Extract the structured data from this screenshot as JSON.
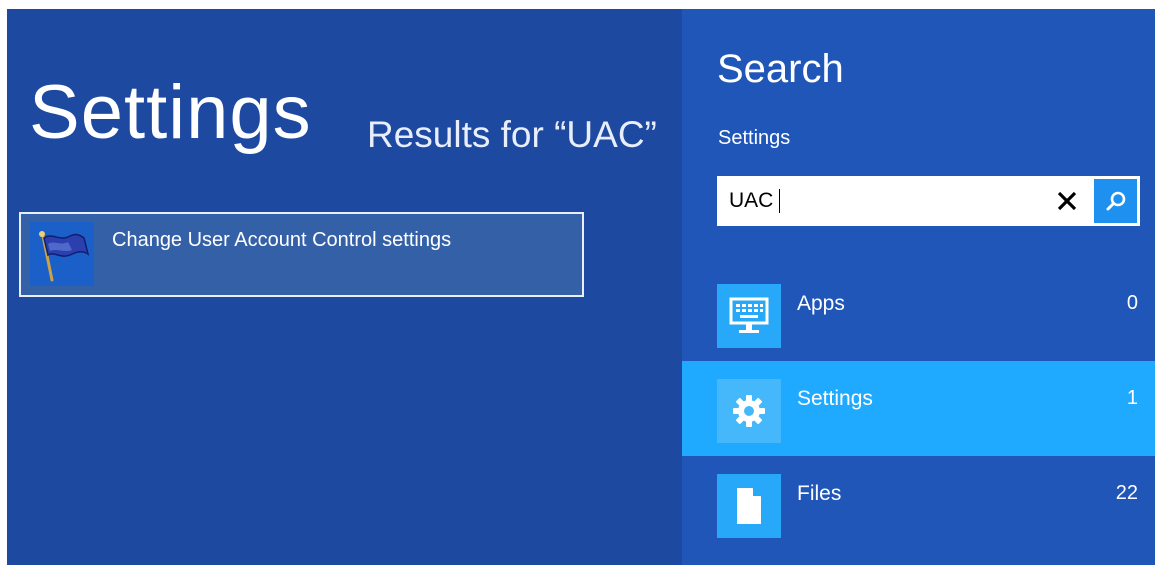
{
  "left_pane": {
    "title": "Settings",
    "results_caption": "Results for “UAC”",
    "result": {
      "label": "Change User Account Control settings",
      "icon": "uac-flag-icon"
    }
  },
  "search_pane": {
    "heading": "Search",
    "scope_label": "Settings",
    "query": "UAC",
    "clear_icon": "close-icon",
    "search_icon": "search-icon",
    "scopes": [
      {
        "name": "Apps",
        "count": "0",
        "icon": "keyboard-monitor-icon",
        "selected": false
      },
      {
        "name": "Settings",
        "count": "1",
        "icon": "gear-icon",
        "selected": true
      },
      {
        "name": "Files",
        "count": "22",
        "icon": "document-icon",
        "selected": false
      }
    ]
  },
  "colors": {
    "left_background": "#1d4aa0",
    "right_background": "#1f56b8",
    "selected_row": "#20aaff",
    "search_button": "#1e90f0"
  }
}
